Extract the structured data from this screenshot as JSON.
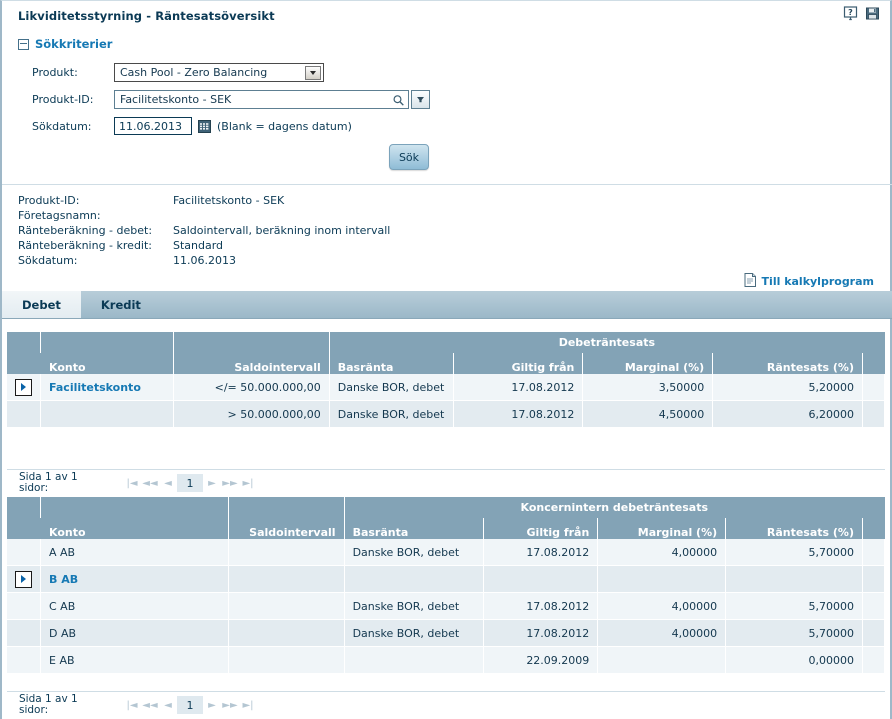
{
  "header": {
    "title": "Likviditetsstyrning - Räntesatsöversikt",
    "icons": [
      {
        "name": "help-icon",
        "glyph": "?"
      },
      {
        "name": "print-icon",
        "glyph": "save"
      }
    ]
  },
  "criteria": {
    "section_title": "Sökkriterier",
    "produkt": {
      "label": "Produkt:",
      "value": "Cash Pool - Zero Balancing",
      "options": [
        "Cash Pool - Zero Balancing"
      ]
    },
    "produkt_id": {
      "label": "Produkt-ID:",
      "value": "Facilitetskonto - SEK",
      "placeholder": ""
    },
    "sokdatum": {
      "label": "Sökdatum:",
      "value": "11.06.2013",
      "hint": "(Blank = dagens datum)"
    },
    "search_button": "Sök"
  },
  "summary": {
    "rows": [
      {
        "key": "Produkt-ID:",
        "value": "Facilitetskonto - SEK"
      },
      {
        "key": "Företagsnamn:",
        "value": ""
      },
      {
        "key": "Ränteberäkning - debet:",
        "value": "Saldointervall, beräkning inom intervall"
      },
      {
        "key": "Ränteberäkning - kredit:",
        "value": "Standard"
      },
      {
        "key": "Sökdatum:",
        "value": "11.06.2013"
      }
    ],
    "calc_link": "Till kalkylprogram"
  },
  "tabs": [
    {
      "label": "Debet",
      "active": true
    },
    {
      "label": "Kredit",
      "active": false
    }
  ],
  "table1": {
    "group_header": "Debeträntesats",
    "columns": [
      "Konto",
      "Saldointervall",
      "Basränta",
      "Giltig från",
      "Marginal (%)",
      "Räntesats (%)"
    ],
    "rows": [
      {
        "expandable": true,
        "konto": "Facilitetskonto",
        "konto_link": true,
        "saldointervall": "</= 50.000.000,00",
        "basranta": "Danske BOR, debet",
        "giltig_fran": "17.08.2012",
        "marginal": "3,50000",
        "rantesats": "5,20000"
      },
      {
        "expandable": false,
        "konto": "",
        "konto_link": false,
        "saldointervall": "> 50.000.000,00",
        "basranta": "Danske BOR, debet",
        "giltig_fran": "17.08.2012",
        "marginal": "4,50000",
        "rantesats": "6,20000"
      }
    ],
    "pager": {
      "label": "Sida 1 av 1 sidor:",
      "first": "|◄",
      "prev_fast": "◄◄",
      "prev": "◄",
      "current": "1",
      "next": "►",
      "next_fast": "►►",
      "last": "►|"
    }
  },
  "table2": {
    "group_header": "Koncernintern debeträntesats",
    "columns": [
      "Konto",
      "Saldointervall",
      "Basränta",
      "Giltig från",
      "Marginal (%)",
      "Räntesats (%)"
    ],
    "rows": [
      {
        "expandable": false,
        "konto": "A AB",
        "konto_link": false,
        "saldointervall": "",
        "basranta": "Danske BOR, debet",
        "giltig_fran": "17.08.2012",
        "marginal": "4,00000",
        "rantesats": "5,70000"
      },
      {
        "expandable": true,
        "konto": "B AB",
        "konto_link": true,
        "saldointervall": "",
        "basranta": "",
        "giltig_fran": "",
        "marginal": "",
        "rantesats": ""
      },
      {
        "expandable": false,
        "konto": "C AB",
        "konto_link": false,
        "saldointervall": "",
        "basranta": "Danske BOR, debet",
        "giltig_fran": "17.08.2012",
        "marginal": "4,00000",
        "rantesats": "5,70000"
      },
      {
        "expandable": false,
        "konto": "D AB",
        "konto_link": false,
        "saldointervall": "",
        "basranta": "Danske BOR, debet",
        "giltig_fran": "17.08.2012",
        "marginal": "4,00000",
        "rantesats": "5,70000"
      },
      {
        "expandable": false,
        "konto": "E AB",
        "konto_link": false,
        "saldointervall": "",
        "basranta": "",
        "giltig_fran": "22.09.2009",
        "marginal": "",
        "rantesats": "0,00000"
      }
    ],
    "pager": {
      "label": "Sida 1 av 1 sidor:",
      "first": "|◄",
      "prev_fast": "◄◄",
      "prev": "◄",
      "current": "1",
      "next": "►",
      "next_fast": "►►",
      "last": "►|"
    }
  },
  "colors": {
    "header_blue": "#83a3b6",
    "link_blue": "#1679b4",
    "text_dark": "#0b3a55",
    "row_odd": "#f0f5f8",
    "row_even": "#e3ebf0"
  }
}
